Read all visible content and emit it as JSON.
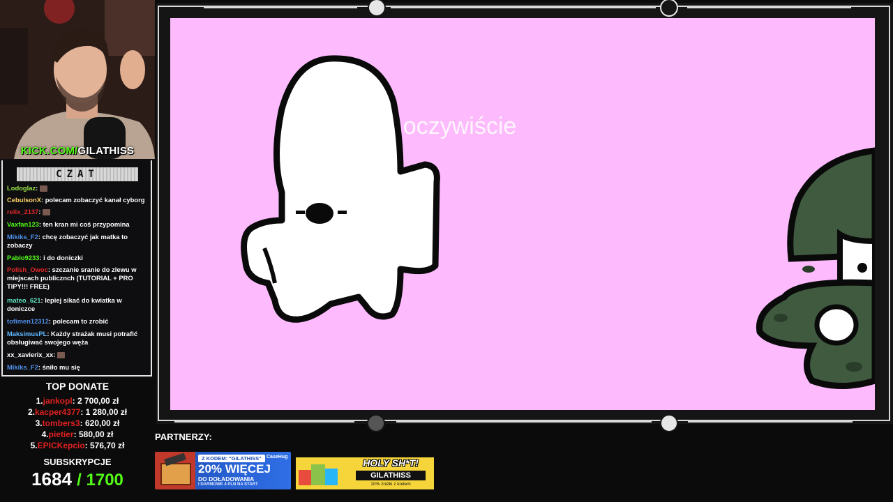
{
  "stream": {
    "kick_url_prefix": "KICK.COM/",
    "kick_channel": "GILATHISS"
  },
  "chat": {
    "title": "CZAT",
    "messages": [
      {
        "user": "Lodoglaz",
        "color": "#9be64a",
        "text": ""
      },
      {
        "user": "CebulsonX",
        "color": "#ffd36a",
        "text": "polecam zobaczyć kanał cyborg"
      },
      {
        "user": "relix_2137",
        "color": "#e02828",
        "text": ""
      },
      {
        "user": "Vaxfan123",
        "color": "#53fc18",
        "text": "ten kran mi coś przypomina"
      },
      {
        "user": "Mikiks_F2",
        "color": "#4f8fe8",
        "text": "chcę zobaczyć jak matka to zobaczy"
      },
      {
        "user": "Pablo9233",
        "color": "#53fc18",
        "text": "i do doniczki"
      },
      {
        "user": "Polish_Owoc",
        "color": "#e02828",
        "text": "szczanie sranie do zlewu w miejscach publicznch (TUTORIAL + PRO TIPY!!! FREE)"
      },
      {
        "user": "mateo_621",
        "color": "#5fe3c0",
        "text": "lepiej sikać do kwiatka w doniczce"
      },
      {
        "user": "tofimen12312",
        "color": "#4f8fe8",
        "text": "polecam to zrobić"
      },
      {
        "user": "MaksimusPL",
        "color": "#5fb8ff",
        "text": "Każdy strażak musi potrafić obsługiwać swojego węża"
      },
      {
        "user": "xx_xavierix_xx",
        "color": "#ffffff",
        "text": ""
      },
      {
        "user": "Mikiks_F2",
        "color": "#4f8fe8",
        "text": "śniło mu się"
      }
    ]
  },
  "top_donate": {
    "title": "TOP DONATE",
    "entries": [
      {
        "rank": "1.",
        "name": "jankopl",
        "amount": ": 2 700,00 zł"
      },
      {
        "rank": "2.",
        "name": "kacper4377",
        "amount": ": 1 280,00 zł"
      },
      {
        "rank": "3.",
        "name": "tombers3",
        "amount": ": 620,00 zł"
      },
      {
        "rank": "4.",
        "name": "pietier",
        "amount": ": 580,00 zł"
      },
      {
        "rank": "5.",
        "name": "EPICKepcio",
        "amount": ": 576,70 zł"
      }
    ]
  },
  "subs": {
    "title": "SUBSKRYPCJE",
    "current": "1684",
    "goal": "/ 1700"
  },
  "video": {
    "subtitle": "to oczywiście",
    "background": "#fdbafd"
  },
  "partners": {
    "label": "PARTNERZY:",
    "banner1": {
      "code_line": "Z KODEM: \"GILATHISS\"",
      "brand": "CaseHug",
      "headline": "20% WIĘCEJ",
      "sub1": "DO DOŁADOWANIA",
      "sub2": "I DARMOWE 4 PLN NA START"
    },
    "banner2": {
      "headline": "HOLY SH*T!",
      "code": "GILATHISS",
      "note": "10% zniżki z kodem"
    }
  }
}
